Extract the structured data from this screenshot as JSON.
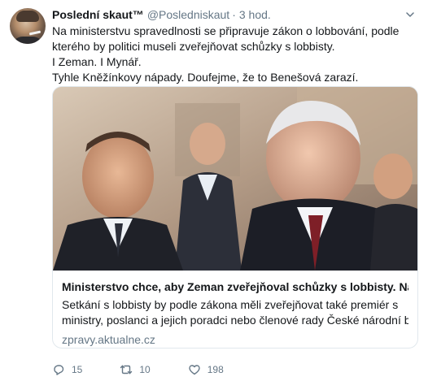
{
  "tweet": {
    "display_name": "Poslední skaut™",
    "handle": "@Posledniskaut",
    "separator": "·",
    "time": "3 hod.",
    "text_lines": [
      "Na ministerstvu spravedlnosti se připravuje zákon o lobbování, podle",
      "kterého by politici museli zveřejňovat schůzky s lobbisty.",
      "I Zeman. I Mynář.",
      "Tyhle Kněžínkovy nápady. Doufejme, že to Benešová zarazí."
    ]
  },
  "card": {
    "title": "Ministerstvo chce, aby Zeman zveřejňoval schůzky s lobbisty. Na...",
    "description_lines": [
      "Setkání s lobbisty by podle zákona měli zveřejňovat také premiér s",
      "ministry, poslanci a jejich poradci nebo členové rady České národní ban..."
    ],
    "domain": "zpravy.aktualne.cz"
  },
  "actions": {
    "reply_count": "15",
    "retweet_count": "10",
    "like_count": "198"
  },
  "icons": {
    "caret": "chevron-down-icon",
    "reply": "reply-icon",
    "retweet": "retweet-icon",
    "like": "heart-icon"
  },
  "colors": {
    "secondary_text": "#657786",
    "primary_text": "#14171a",
    "border": "#e1e8ed"
  }
}
